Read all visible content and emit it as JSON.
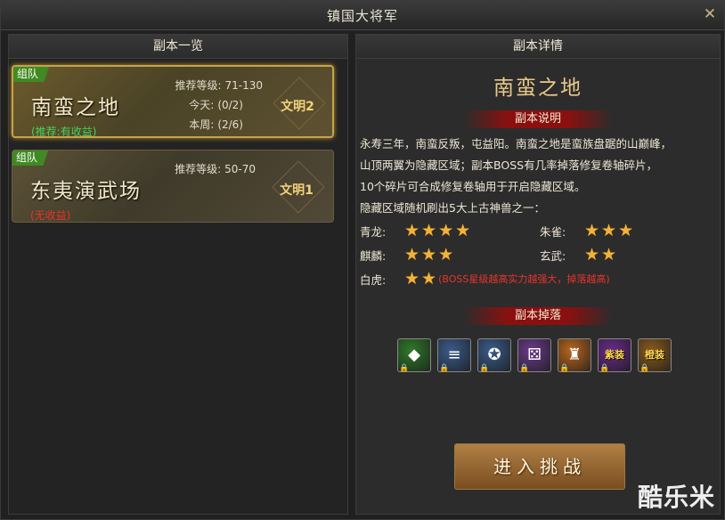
{
  "window": {
    "title": "镇国大将军"
  },
  "left_panel": {
    "header": "副本一览",
    "dungeons": [
      {
        "team_tag": "组队",
        "name": "南蛮之地",
        "reward": "(推荐:有收益)",
        "reward_status": "good",
        "rec_level_label": "推荐等级:",
        "rec_level": "71-130",
        "today_label": "今天:",
        "today": "(0/2)",
        "week_label": "本周:",
        "week": "(2/6)",
        "badge": "文明2",
        "selected": true
      },
      {
        "team_tag": "组队",
        "name": "东夷演武场",
        "reward": "(无收益)",
        "reward_status": "bad",
        "rec_level_label": "推荐等级:",
        "rec_level": "50-70",
        "badge": "文明1",
        "selected": false
      }
    ]
  },
  "right_panel": {
    "header": "副本详情",
    "title": "南蛮之地",
    "desc_banner": "副本说明",
    "desc_lines": [
      "永寿三年，南蛮反叛，屯益阳。南蛮之地是蛮族盘踞的山巅峰，",
      "山顶两翼为隐藏区域；副本BOSS有几率掉落修复卷轴碎片，",
      "10个碎片可合成修复卷轴用于开启隐藏区域。",
      "隐藏区域随机刷出5大上古神兽之一："
    ],
    "beasts": [
      {
        "name": "青龙:",
        "stars": 4
      },
      {
        "name": "朱雀:",
        "stars": 3
      },
      {
        "name": "麒麟:",
        "stars": 3
      },
      {
        "name": "玄武:",
        "stars": 2
      },
      {
        "name": "白虎:",
        "stars": 2
      }
    ],
    "boss_note": "(BOSS星级越高实力越强大，掉落越高)",
    "drops_banner": "副本掉落",
    "drops": [
      {
        "icon": "red-gem-icon",
        "color": "#2f7a2a",
        "glyph": "◆"
      },
      {
        "icon": "scroll-map-icon",
        "color": "#3a5b8a",
        "glyph": "≡"
      },
      {
        "icon": "scroll-emblem-icon",
        "color": "#3a5b8a",
        "glyph": "✪"
      },
      {
        "icon": "dice-icon",
        "color": "#6a3a8a",
        "glyph": "⚄"
      },
      {
        "icon": "armor-icon",
        "color": "#b8651e",
        "glyph": "♜"
      },
      {
        "icon": "purple-equip-icon",
        "color": "#6a2a8a",
        "glyph": "",
        "tag": "紫装"
      },
      {
        "icon": "gold-equip-icon",
        "color": "#8a5a1e",
        "glyph": "",
        "tag": "橙装"
      }
    ],
    "enter_button": "进入挑战"
  },
  "watermark": "酷乐米"
}
